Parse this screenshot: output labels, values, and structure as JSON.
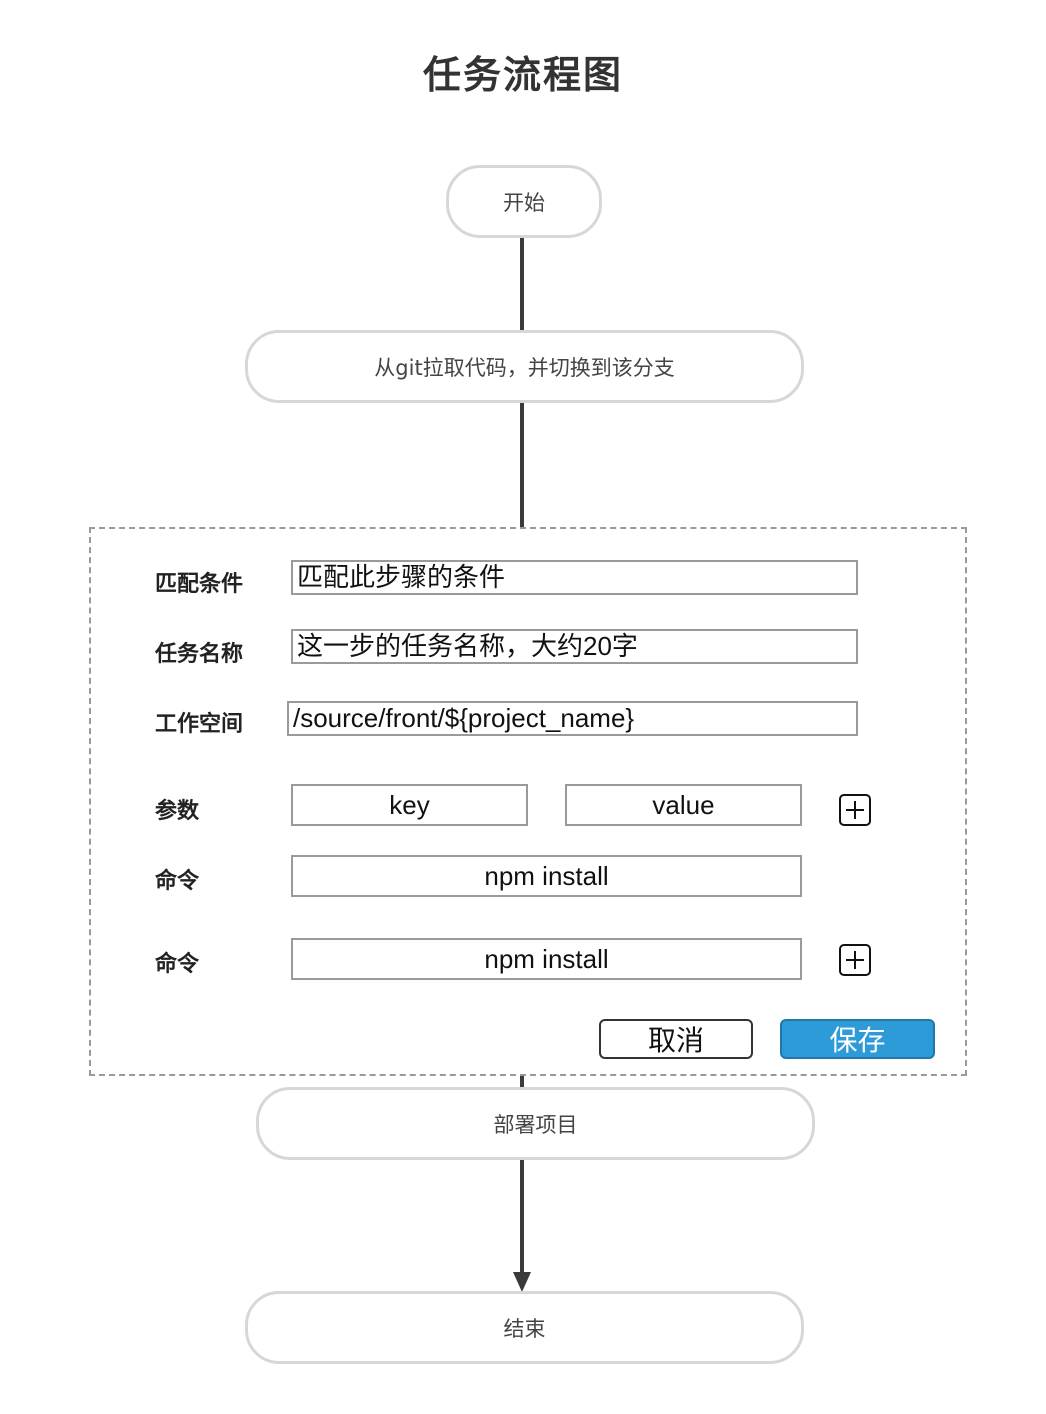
{
  "title": "任务流程图",
  "nodes": {
    "start": "开始",
    "git": "从git拉取代码，并切换到该分支",
    "deploy": "部署项目",
    "end": "结束"
  },
  "form": {
    "match_label": "匹配条件",
    "match_value": "匹配此步骤的条件",
    "name_label": "任务名称",
    "name_value": "这一步的任务名称，大约20字",
    "workspace_label": "工作空间",
    "workspace_value": "/source/front/${project_name}",
    "params_label": "参数",
    "param_key": "key",
    "param_value": "value",
    "command_label_1": "命令",
    "command_value_1": "npm install",
    "command_label_2": "命令",
    "command_value_2": "npm install",
    "cancel_label": "取消",
    "save_label": "保存"
  },
  "colors": {
    "save_button": "#2d9bd8",
    "node_border": "#d7d7d7",
    "connector": "#3a3a3a"
  },
  "icons": [
    "plus-square-icon"
  ]
}
